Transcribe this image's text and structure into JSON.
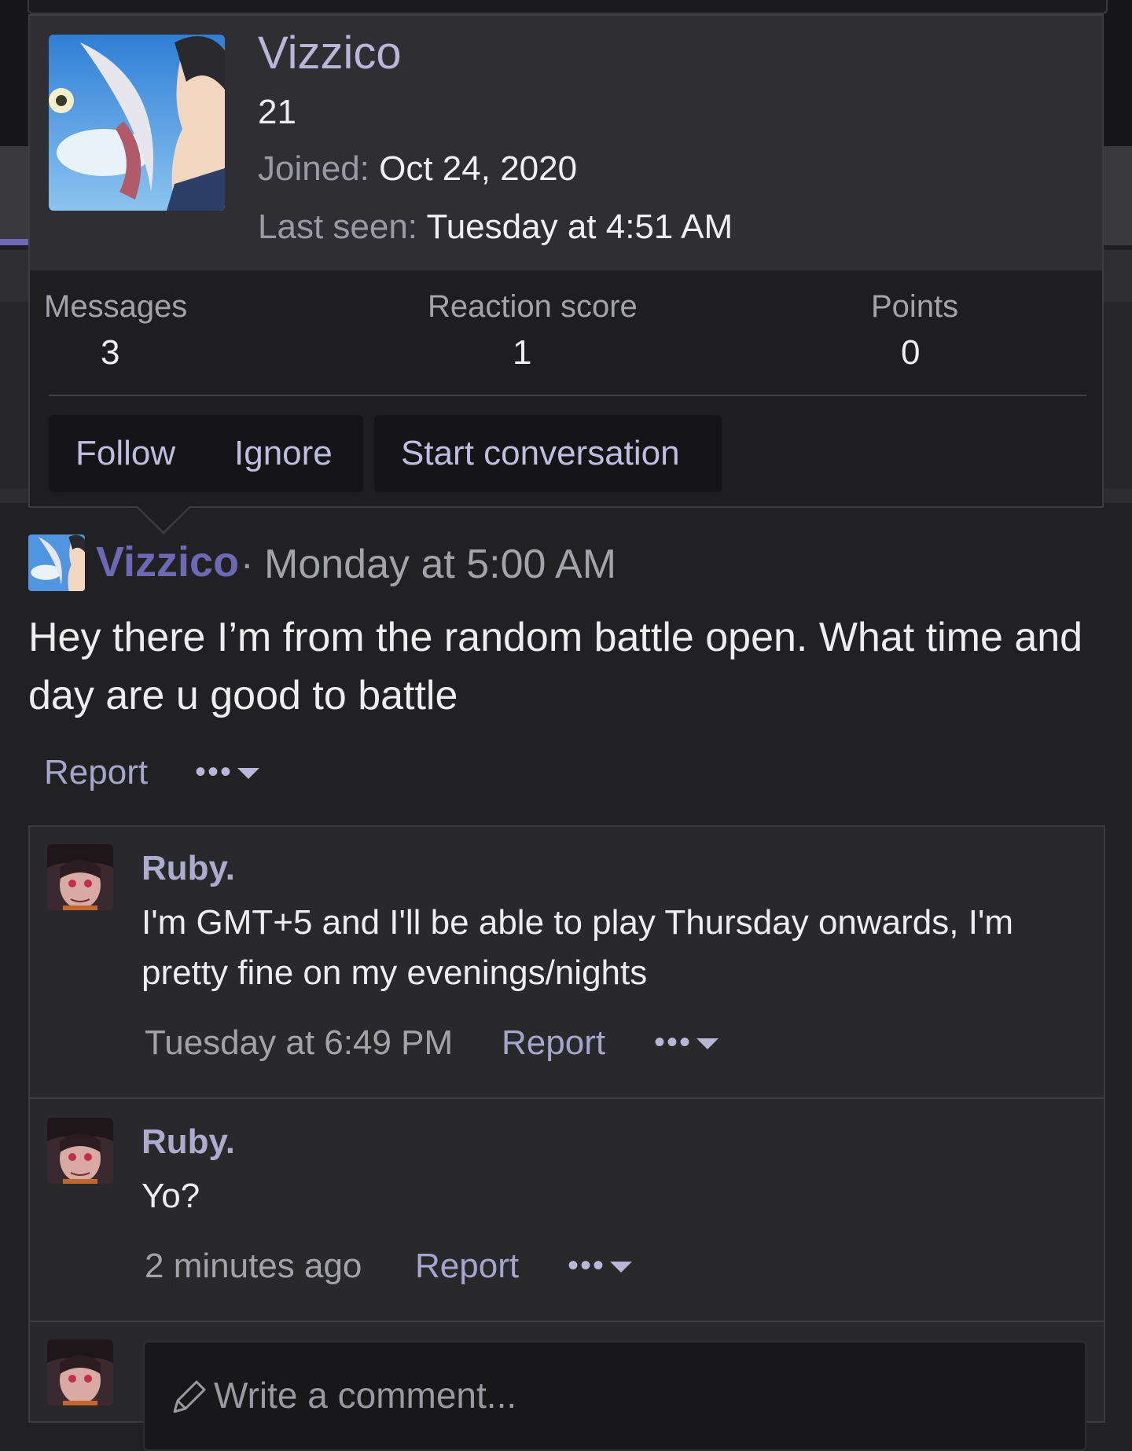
{
  "profile_popup": {
    "name": "Vizzico",
    "age": "21",
    "joined_label": "Joined:",
    "joined_value": "Oct 24, 2020",
    "last_seen_label": "Last seen:",
    "last_seen_value": "Tuesday at 4:51 AM",
    "stats": [
      {
        "label": "Messages",
        "value": "3"
      },
      {
        "label": "Reaction score",
        "value": "1"
      },
      {
        "label": "Points",
        "value": "0"
      }
    ],
    "buttons": {
      "follow": "Follow",
      "ignore": "Ignore",
      "start_conversation": "Start conversation"
    }
  },
  "post": {
    "author": "Vizzico",
    "separator": "·",
    "time": "Monday at 5:00 AM",
    "body": "Hey there I’m from the random battle open. What time and day are u good to battle",
    "report": "Report",
    "more": "•••"
  },
  "comments": [
    {
      "author": "Ruby.",
      "text": "I'm GMT+5 and I'll be able to play Thursday onwards, I'm pretty fine on my evenings/nights",
      "time": "Tuesday at 6:49 PM",
      "report": "Report",
      "more": "•••"
    },
    {
      "author": "Ruby.",
      "text": "Yo?",
      "time": "2 minutes ago",
      "report": "Report",
      "more": "•••"
    }
  ],
  "comment_box": {
    "placeholder": "Write a comment..."
  },
  "icons": {
    "pencil": "pencil-icon",
    "dropdown": "chevron-down-icon"
  },
  "colors": {
    "accent": "#6f68b6",
    "link": "#a8a5cc",
    "background": "#212123",
    "popup_header": "#2f2f33"
  }
}
